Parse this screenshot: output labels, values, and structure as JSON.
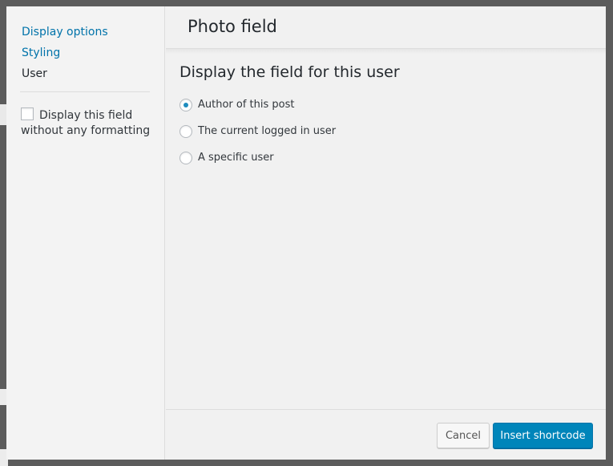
{
  "sidebar": {
    "menu": [
      "Display options",
      "Styling",
      "User"
    ],
    "active_index": 2,
    "checkbox": {
      "label": "Display this field without any formatting",
      "checked": false
    }
  },
  "header": {
    "title": "Photo field"
  },
  "main": {
    "section_title": "Display the field for this user",
    "options": [
      {
        "label": "Author of this post",
        "checked": true
      },
      {
        "label": "The current logged in user",
        "checked": false
      },
      {
        "label": "A specific user",
        "checked": false
      }
    ]
  },
  "footer": {
    "cancel_label": "Cancel",
    "insert_label": "Insert shortcode"
  },
  "colors": {
    "link": "#0073aa",
    "primary_button": "#0085ba",
    "overlay": "#5c5c5c"
  }
}
